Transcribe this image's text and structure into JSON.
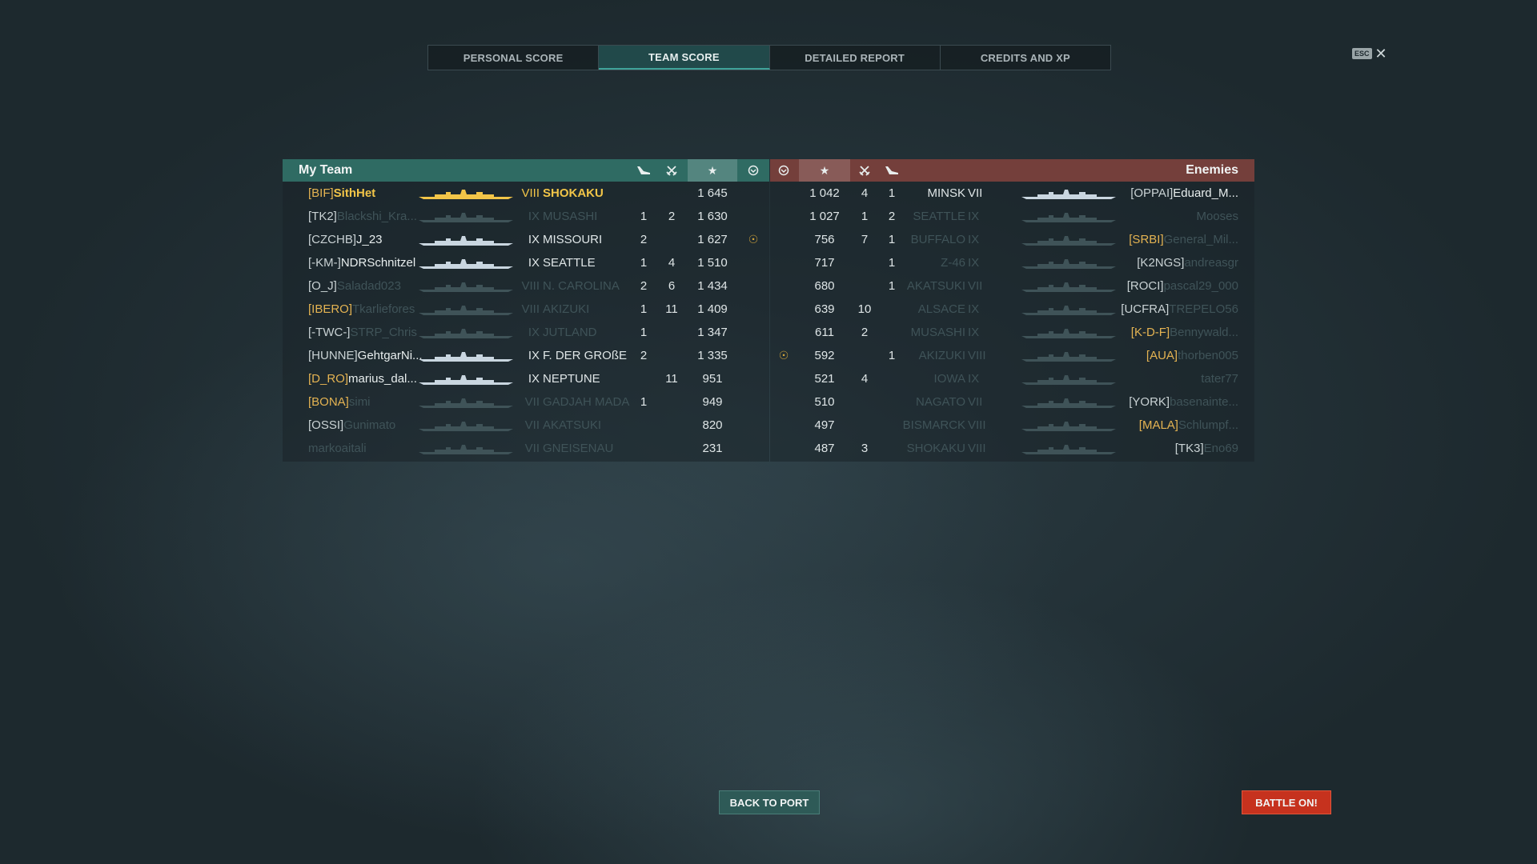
{
  "tabs": [
    "PERSONAL SCORE",
    "TEAM SCORE",
    "DETAILED REPORT",
    "CREDITS AND XP"
  ],
  "active_tab": 1,
  "esc_label": "ESC",
  "close_glyph": "✕",
  "my_team": {
    "title": "My Team",
    "icons": {
      "planes": "plane-icon",
      "kills": "crossed-swords-icon",
      "score": "★",
      "base": "base-capture-icon"
    },
    "rows": [
      {
        "clan": "[BIF]",
        "name": "SithHet",
        "tier": "VIII",
        "ship": "SHOKAKU",
        "planes": "",
        "kills": "",
        "score": "1 645",
        "medal": "",
        "style": "self"
      },
      {
        "clan": "[TK2]",
        "name": "Blackshi_Kra...",
        "tier": "IX",
        "ship": "MUSASHI",
        "planes": "1",
        "kills": "2",
        "score": "1 630",
        "medal": "",
        "style": "dead"
      },
      {
        "clan": "[CZCHB]",
        "name": "J_23",
        "tier": "IX",
        "ship": "MISSOURI",
        "planes": "2",
        "kills": "",
        "score": "1 627",
        "medal": "☉",
        "style": "alive"
      },
      {
        "clan": "[-KM-]",
        "name": "NDRSchnitzel",
        "tier": "IX",
        "ship": "SEATTLE",
        "planes": "1",
        "kills": "4",
        "score": "1 510",
        "medal": "",
        "style": "alive"
      },
      {
        "clan": "[O_J]",
        "name": "Saladad023",
        "tier": "VIII",
        "ship": "N. CAROLINA",
        "planes": "2",
        "kills": "6",
        "score": "1 434",
        "medal": "",
        "style": "dead"
      },
      {
        "clan": "[IBERO]",
        "name": "Tkarliefores",
        "tier": "VIII",
        "ship": "AKIZUKI",
        "planes": "1",
        "kills": "11",
        "score": "1 409",
        "medal": "",
        "style": "dead-goldclan"
      },
      {
        "clan": "[-TWC-]",
        "name": "STRP_Chris",
        "tier": "IX",
        "ship": "JUTLAND",
        "planes": "1",
        "kills": "",
        "score": "1 347",
        "medal": "",
        "style": "dead"
      },
      {
        "clan": "[HUNNE]",
        "name": "GehtgarNi...",
        "tier": "IX",
        "ship": "F. DER GROßE",
        "planes": "2",
        "kills": "",
        "score": "1 335",
        "medal": "",
        "style": "alive"
      },
      {
        "clan": "[D_RO]",
        "name": "marius_dal...",
        "tier": "IX",
        "ship": "NEPTUNE",
        "planes": "",
        "kills": "11",
        "score": "951",
        "medal": "",
        "style": "alive-goldclan"
      },
      {
        "clan": "[BONA]",
        "name": "simi",
        "tier": "VII",
        "ship": "GADJAH MADA",
        "planes": "1",
        "kills": "",
        "score": "949",
        "medal": "",
        "style": "dead-goldclan"
      },
      {
        "clan": "[OSSI]",
        "name": "Gunimato",
        "tier": "VII",
        "ship": "AKATSUKI",
        "planes": "",
        "kills": "",
        "score": "820",
        "medal": "",
        "style": "dead"
      },
      {
        "clan": "",
        "name": "markoaitali",
        "tier": "VII",
        "ship": "GNEISENAU",
        "planes": "",
        "kills": "",
        "score": "231",
        "medal": "",
        "style": "dead"
      }
    ]
  },
  "enemies": {
    "title": "Enemies",
    "rows": [
      {
        "medal": "",
        "score": "1 042",
        "kills": "4",
        "planes": "1",
        "ship": "MINSK",
        "tier": "VII",
        "clan": "[OPPAI]",
        "name": "Eduard_M...",
        "style": "alive"
      },
      {
        "medal": "",
        "score": "1 027",
        "kills": "1",
        "planes": "2",
        "ship": "SEATTLE",
        "tier": "IX",
        "clan": "",
        "name": "Mooses",
        "style": "dead"
      },
      {
        "medal": "",
        "score": "756",
        "kills": "7",
        "planes": "1",
        "ship": "BUFFALO",
        "tier": "IX",
        "clan": "[SRBI]",
        "name": "General_Mil...",
        "style": "dead-goldclan"
      },
      {
        "medal": "",
        "score": "717",
        "kills": "",
        "planes": "1",
        "ship": "Z-46",
        "tier": "IX",
        "clan": "[K2NGS]",
        "name": "andreasgr",
        "style": "dead-whiteclan"
      },
      {
        "medal": "",
        "score": "680",
        "kills": "",
        "planes": "1",
        "ship": "AKATSUKI",
        "tier": "VII",
        "clan": "[ROCI]",
        "name": "pascal29_000",
        "style": "dead-whiteclan"
      },
      {
        "medal": "",
        "score": "639",
        "kills": "10",
        "planes": "",
        "ship": "ALSACE",
        "tier": "IX",
        "clan": "[UCFRA]",
        "name": "TREPELO56",
        "style": "dead-whiteclan"
      },
      {
        "medal": "",
        "score": "611",
        "kills": "2",
        "planes": "",
        "ship": "MUSASHI",
        "tier": "IX",
        "clan": "[K-D-F]",
        "name": "Bennywald...",
        "style": "dead-goldclan"
      },
      {
        "medal": "☉",
        "score": "592",
        "kills": "",
        "planes": "1",
        "ship": "AKIZUKI",
        "tier": "VIII",
        "clan": "[AUA]",
        "name": "thorben005",
        "style": "dead-goldclan"
      },
      {
        "medal": "",
        "score": "521",
        "kills": "4",
        "planes": "",
        "ship": "IOWA",
        "tier": "IX",
        "clan": "",
        "name": "tater77",
        "style": "dead"
      },
      {
        "medal": "",
        "score": "510",
        "kills": "",
        "planes": "",
        "ship": "NAGATO",
        "tier": "VII",
        "clan": "[YORK]",
        "name": "basenainte...",
        "style": "dead-whiteclan"
      },
      {
        "medal": "",
        "score": "497",
        "kills": "",
        "planes": "",
        "ship": "BISMARCK",
        "tier": "VIII",
        "clan": "[MALA]",
        "name": "Schlumpf...",
        "style": "dead-goldclan"
      },
      {
        "medal": "",
        "score": "487",
        "kills": "3",
        "planes": "",
        "ship": "SHOKAKU",
        "tier": "VIII",
        "clan": "[TK3]",
        "name": "Eno69",
        "style": "dead-whiteclan"
      }
    ]
  },
  "buttons": {
    "back": "BACK TO PORT",
    "battle": "BATTLE ON!"
  },
  "colors": {
    "my_team_header": "#2f6b63",
    "enemy_header": "#743f3b",
    "self_highlight": "#f2c548",
    "clan_gold": "#e4b352",
    "battle_button": "#c6321e"
  }
}
